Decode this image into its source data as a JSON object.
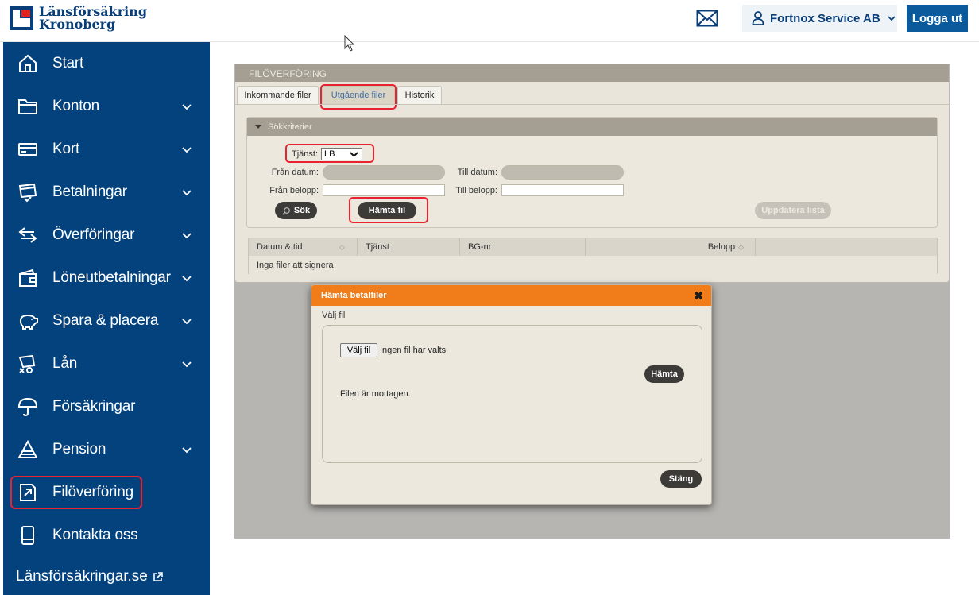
{
  "brand": {
    "line1": "Länsförsäkring",
    "line2": "Kronoberg"
  },
  "header": {
    "mail_icon": "mail-icon",
    "user_name": "Fortnox Service AB",
    "logout_label": "Logga ut"
  },
  "sidebar": {
    "items": [
      {
        "label": "Start",
        "icon": "home-icon",
        "has_chevron": false
      },
      {
        "label": "Konton",
        "icon": "folder-icon",
        "has_chevron": true
      },
      {
        "label": "Kort",
        "icon": "card-icon",
        "has_chevron": true
      },
      {
        "label": "Betalningar",
        "icon": "payment-icon",
        "has_chevron": true
      },
      {
        "label": "Överföringar",
        "icon": "transfer-icon",
        "has_chevron": true
      },
      {
        "label": "Löneutbetalningar",
        "icon": "wallet-icon",
        "has_chevron": true
      },
      {
        "label": "Spara & placera",
        "icon": "piggybank-icon",
        "has_chevron": true
      },
      {
        "label": "Lån",
        "icon": "loan-icon",
        "has_chevron": true
      },
      {
        "label": "Försäkringar",
        "icon": "umbrella-icon",
        "has_chevron": false
      },
      {
        "label": "Pension",
        "icon": "pyramid-icon",
        "has_chevron": true
      },
      {
        "label": "Filöverföring",
        "icon": "file-transfer-icon",
        "has_chevron": false,
        "active": true
      },
      {
        "label": "Kontakta oss",
        "icon": "phone-icon",
        "has_chevron": false
      }
    ],
    "external_link": "Länsförsäkringar.se"
  },
  "app": {
    "title": "FILÖVERFÖRING",
    "tabs": [
      {
        "label": "Inkommande filer",
        "active": false
      },
      {
        "label": "Utgående filer",
        "active": true
      },
      {
        "label": "Historik",
        "active": false
      }
    ],
    "criteria": {
      "header": "Sökkriterier",
      "service_label": "Tjänst:",
      "service_value": "LB",
      "from_date_label": "Från datum:",
      "to_date_label": "Till datum:",
      "from_amount_label": "Från belopp:",
      "to_amount_label": "Till belopp:",
      "search_button": "Sök",
      "fetch_button": "Hämta fil",
      "refresh_button": "Uppdatera lista"
    },
    "table": {
      "columns": [
        "Datum & tid",
        "Tjänst",
        "BG-nr",
        "Belopp"
      ],
      "empty_text": "Inga filer att signera"
    }
  },
  "modal": {
    "title": "Hämta betalfiler",
    "subtitle": "Välj fil",
    "choose_file_button": "Välj fil",
    "no_file_text": "Ingen fil har valts",
    "fetch_button": "Hämta",
    "status_text": "Filen är mottagen.",
    "close_button": "Stäng"
  },
  "colors": {
    "sidebar_bg": "#04427d",
    "brand_blue": "#0a3e78",
    "logout_bg": "#0b5a9c",
    "modal_header": "#f07d19",
    "highlight_red": "#e8232f"
  }
}
